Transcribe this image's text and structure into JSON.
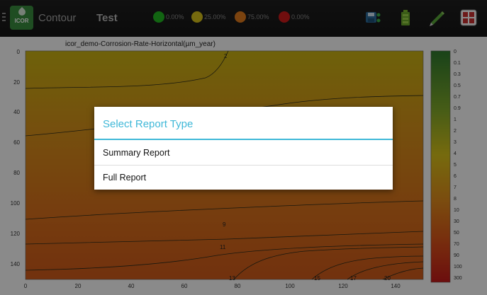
{
  "topbar": {
    "app_name": "Contour",
    "project_name": "Test",
    "logo_text": "ICOR",
    "legend": [
      {
        "label": "0.00%",
        "color": "#22b822"
      },
      {
        "label": "25.00%",
        "color": "#d8c21a"
      },
      {
        "label": "75.00%",
        "color": "#e07a1c"
      },
      {
        "label": "0.00%",
        "color": "#cc1a1a"
      }
    ],
    "icons": [
      "save-export-icon",
      "battery-icon",
      "pen-edit-icon",
      "grid-settings-icon"
    ]
  },
  "plot": {
    "title": "icor_demo-Corrosion-Rate-Horizontal(µm_year)",
    "x_ticks": [
      "0",
      "20",
      "40",
      "60",
      "80",
      "100",
      "120",
      "140"
    ],
    "y_ticks": [
      "0",
      "20",
      "40",
      "60",
      "80",
      "100",
      "120",
      "140"
    ],
    "contour_labels": [
      "2",
      "9",
      "11",
      "13",
      "15",
      "17",
      "20"
    ],
    "colorbar_labels": [
      "0",
      "0.1",
      "0.3",
      "0.5",
      "0.7",
      "0.9",
      "1",
      "2",
      "3",
      "4",
      "5",
      "6",
      "7",
      "8",
      "10",
      "30",
      "50",
      "70",
      "90",
      "100",
      "300"
    ]
  },
  "dialog": {
    "title": "Select Report Type",
    "items": [
      "Summary Report",
      "Full Report"
    ]
  }
}
